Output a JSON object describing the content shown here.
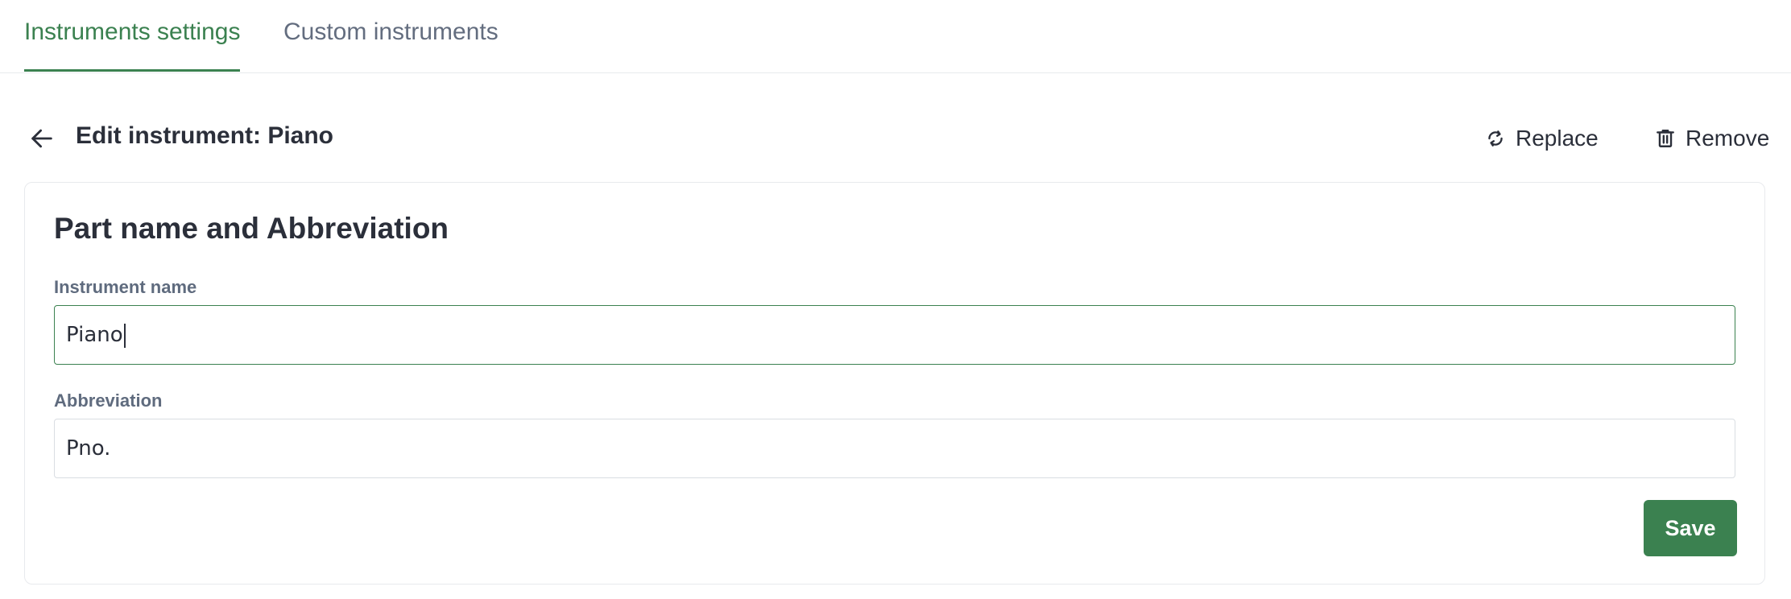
{
  "tabs": [
    {
      "label": "Instruments settings",
      "active": true
    },
    {
      "label": "Custom instruments",
      "active": false
    }
  ],
  "header": {
    "title": "Edit instrument: Piano",
    "back_icon": "arrow-left-icon",
    "actions": {
      "replace": {
        "label": "Replace",
        "icon": "refresh-icon"
      },
      "remove": {
        "label": "Remove",
        "icon": "trash-icon"
      }
    }
  },
  "card": {
    "title": "Part name and Abbreviation",
    "fields": {
      "instrument_name": {
        "label": "Instrument name",
        "value": "Piano"
      },
      "abbreviation": {
        "label": "Abbreviation",
        "value": "Pno."
      }
    },
    "save_label": "Save"
  },
  "colors": {
    "accent": "#3b8150",
    "text": "#2b2f3a",
    "muted": "#636d7f",
    "border": "#e8eaed"
  }
}
